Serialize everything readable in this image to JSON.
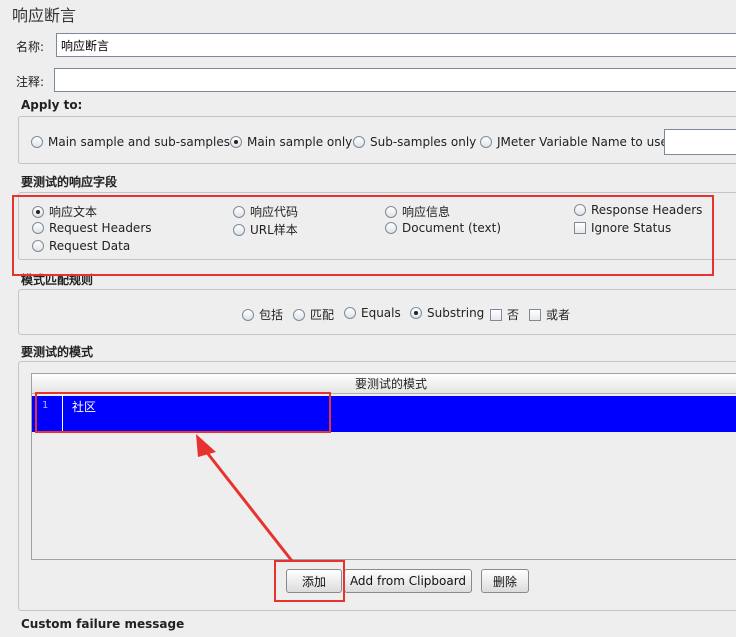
{
  "title": "响应断言",
  "name_label": "名称:",
  "name_value": "响应断言",
  "comment_label": "注释:",
  "comment_value": "",
  "apply_to": {
    "title": "Apply to:",
    "options": [
      "Main sample and sub-samples",
      "Main sample only",
      "Sub-samples only",
      "JMeter Variable Name to use"
    ],
    "selected": "Main sample only",
    "variable_value": ""
  },
  "field": {
    "title": "要测试的响应字段",
    "options": [
      "响应文本",
      "响应代码",
      "响应信息",
      "Response Headers",
      "Request Headers",
      "URL样本",
      "Document (text)",
      "Request Data"
    ],
    "selected": "响应文本",
    "ignore_status": "Ignore Status"
  },
  "rules": {
    "title": "模式匹配规则",
    "contains": "包括",
    "matches": "匹配",
    "equals": "Equals",
    "substring": "Substring",
    "not": "否",
    "or": "或者",
    "selected": "Substring"
  },
  "patterns": {
    "title": "要测试的模式",
    "column_header": "要测试的模式",
    "rows": [
      {
        "num": "1",
        "value": "社区"
      }
    ]
  },
  "buttons": {
    "add": "添加",
    "add_clipboard": "Add from Clipboard",
    "delete": "删除"
  },
  "custom_failure": {
    "title": "Custom failure message"
  },
  "colors": {
    "highlight": "#e8322d",
    "selection": "#0000ff"
  }
}
